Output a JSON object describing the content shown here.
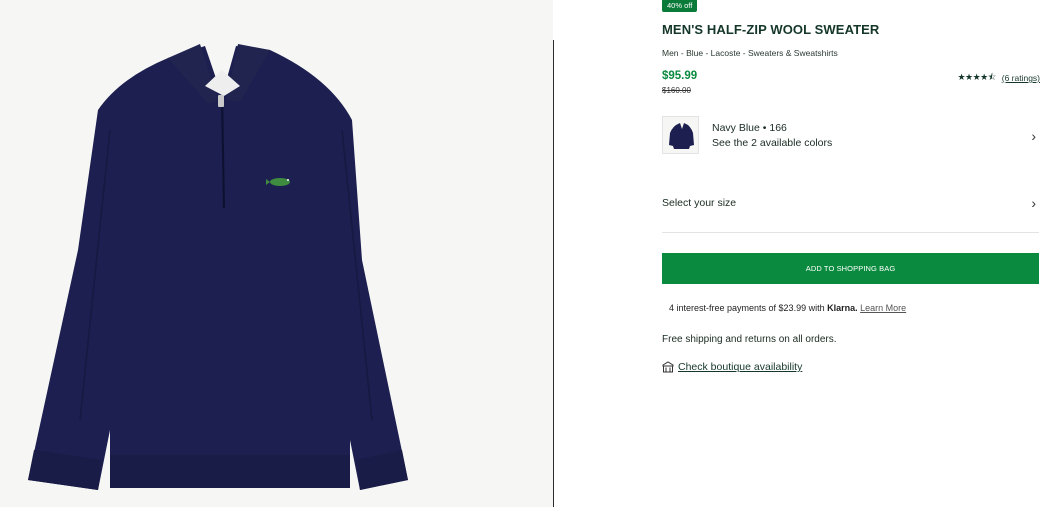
{
  "product": {
    "badge": "40% off",
    "title": "MEN'S HALF-ZIP WOOL SWEATER",
    "breadcrumb": "Men - Blue - Lacoste - Sweaters & Sweatshirts",
    "price": "$95.99",
    "old_price": "$160.00",
    "rating_stars": 4.5,
    "rating_link": "(6 ratings)",
    "colors": {
      "accent": "#0a8a3f",
      "sweater": "#1c1f4f"
    }
  },
  "color_selector": {
    "name": "Navy Blue • 166",
    "sub": "See the 2 available colors"
  },
  "size_selector": {
    "label": "Select your size"
  },
  "cart": {
    "add_label": "ADD TO SHOPPING BAG"
  },
  "klarna": {
    "text": "4 interest-free payments of $23.99 with",
    "brand": "Klarna.",
    "link": "Learn More"
  },
  "shipping": {
    "text": "Free shipping and returns on all orders."
  },
  "boutique": {
    "link": "Check boutique availability"
  },
  "icons": [
    "star-icon",
    "chevron-right-icon",
    "store-icon",
    "crocodile-logo"
  ]
}
